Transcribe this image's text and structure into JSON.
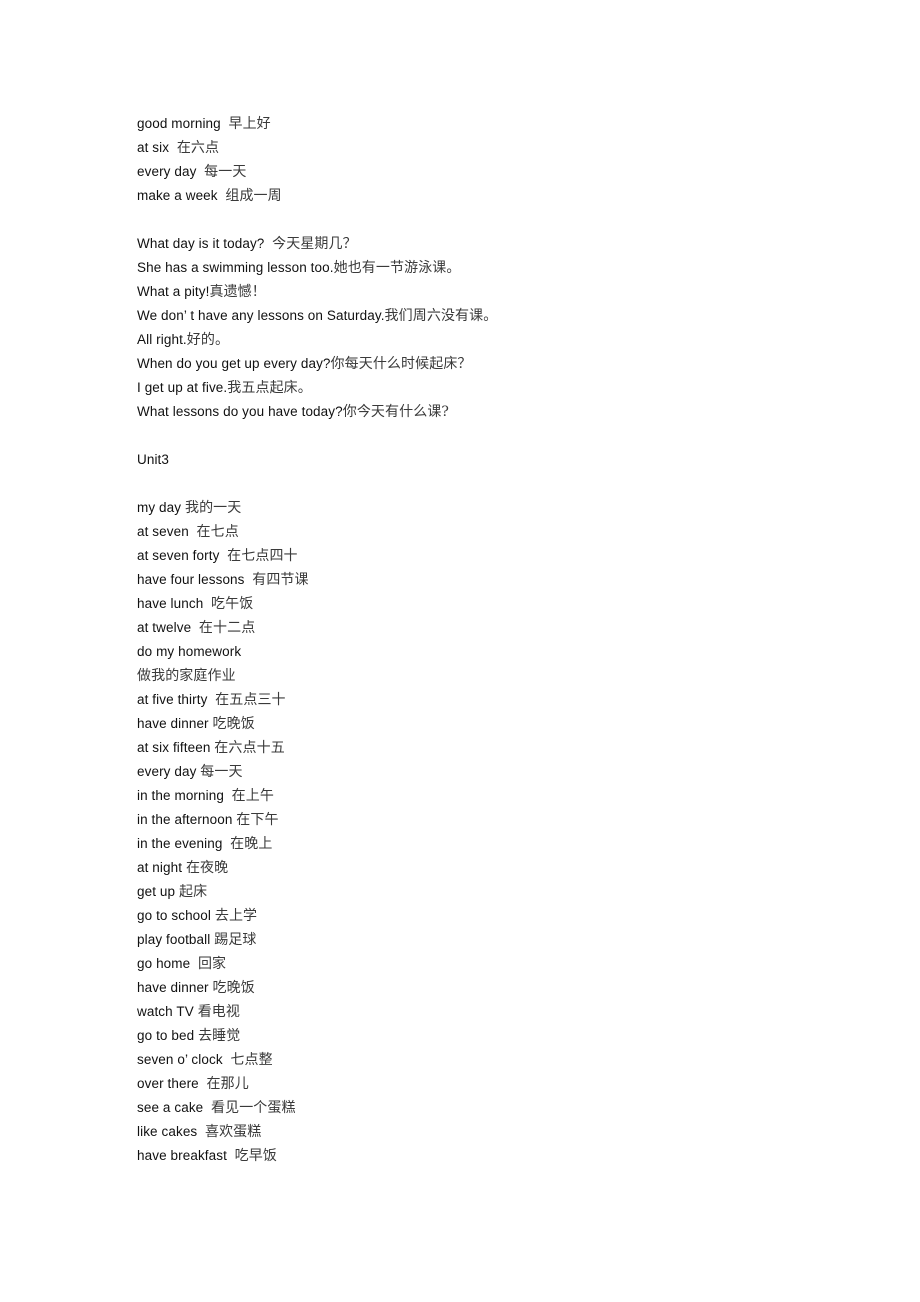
{
  "document": {
    "background_color": "#ffffff",
    "text_color": "#111111",
    "cjk_text_color": "#3a3a3a",
    "blocks": [
      {
        "name": "vocabulary-block-unit2",
        "lines": [
          {
            "en": "good morning",
            "cn": "早上好",
            "sep": "  "
          },
          {
            "en": "at six",
            "cn": "在六点",
            "sep": "  "
          },
          {
            "en": "every day",
            "cn": "每一天",
            "sep": "  "
          },
          {
            "en": "make a week",
            "cn": "组成一周",
            "sep": "  "
          }
        ]
      },
      {
        "name": "sentence-block-unit2",
        "lines": [
          {
            "en": "What day is it today?",
            "cn": "今天星期几？",
            "sep": "  "
          },
          {
            "en": "She has a swimming lesson too.",
            "cn": "她也有一节游泳课。",
            "sep": ""
          },
          {
            "en": "What a pity!",
            "cn": "真遗憾！",
            "sep": ""
          },
          {
            "en": "We don’ t have any lessons on Saturday.",
            "cn": "我们周六没有课。",
            "sep": ""
          },
          {
            "en": "All right.",
            "cn": "好的。",
            "sep": ""
          },
          {
            "en": "When do you get up every day?",
            "cn": "你每天什么时候起床？",
            "sep": ""
          },
          {
            "en": "I get up at five.",
            "cn": "我五点起床。",
            "sep": ""
          },
          {
            "en": "What lessons do you have today?",
            "cn": "你今天有什么课?",
            "sep": ""
          }
        ]
      },
      {
        "name": "unit-heading-block",
        "lines": [
          {
            "en": "Unit3",
            "cn": "",
            "sep": ""
          }
        ]
      },
      {
        "name": "vocabulary-block-unit3",
        "lines": [
          {
            "en": "my day",
            "cn": "我的一天",
            "sep": " "
          },
          {
            "en": "at seven",
            "cn": "在七点",
            "sep": "  "
          },
          {
            "en": "at seven forty",
            "cn": "在七点四十",
            "sep": "  "
          },
          {
            "en": "have four lessons",
            "cn": "有四节课",
            "sep": "  "
          },
          {
            "en": "have lunch",
            "cn": "吃午饭",
            "sep": "  "
          },
          {
            "en": "at twelve",
            "cn": "在十二点",
            "sep": "  "
          },
          {
            "en": "do my homework",
            "cn": "",
            "sep": ""
          },
          {
            "en": "",
            "cn": "做我的家庭作业",
            "sep": ""
          },
          {
            "en": "at five thirty",
            "cn": "在五点三十",
            "sep": "  "
          },
          {
            "en": "have dinner",
            "cn": "吃晚饭",
            "sep": " "
          },
          {
            "en": "at six fifteen",
            "cn": "在六点十五",
            "sep": " "
          },
          {
            "en": "every day",
            "cn": "每一天",
            "sep": " "
          },
          {
            "en": "in the morning",
            "cn": "在上午",
            "sep": "  "
          },
          {
            "en": "in the afternoon",
            "cn": "在下午",
            "sep": " "
          },
          {
            "en": "in the evening",
            "cn": "在晚上",
            "sep": "  "
          },
          {
            "en": "at night",
            "cn": "在夜晚",
            "sep": " "
          },
          {
            "en": "get up",
            "cn": "起床",
            "sep": " "
          },
          {
            "en": "go to school",
            "cn": "去上学",
            "sep": " "
          },
          {
            "en": "play football",
            "cn": "踢足球",
            "sep": " "
          },
          {
            "en": "go home",
            "cn": "回家",
            "sep": "  "
          },
          {
            "en": "have dinner",
            "cn": "吃晚饭",
            "sep": " "
          },
          {
            "en": "watch TV",
            "cn": "看电视",
            "sep": " "
          },
          {
            "en": "go to bed",
            "cn": "去睡觉",
            "sep": " "
          },
          {
            "en": "seven o’ clock",
            "cn": "七点整",
            "sep": "  "
          },
          {
            "en": "over there",
            "cn": "在那儿",
            "sep": "  "
          },
          {
            "en": "see a cake",
            "cn": "看见一个蛋糕",
            "sep": "  "
          },
          {
            "en": "like cakes",
            "cn": "喜欢蛋糕",
            "sep": "  "
          },
          {
            "en": "have breakfast",
            "cn": "吃早饭",
            "sep": "  "
          }
        ]
      }
    ]
  }
}
